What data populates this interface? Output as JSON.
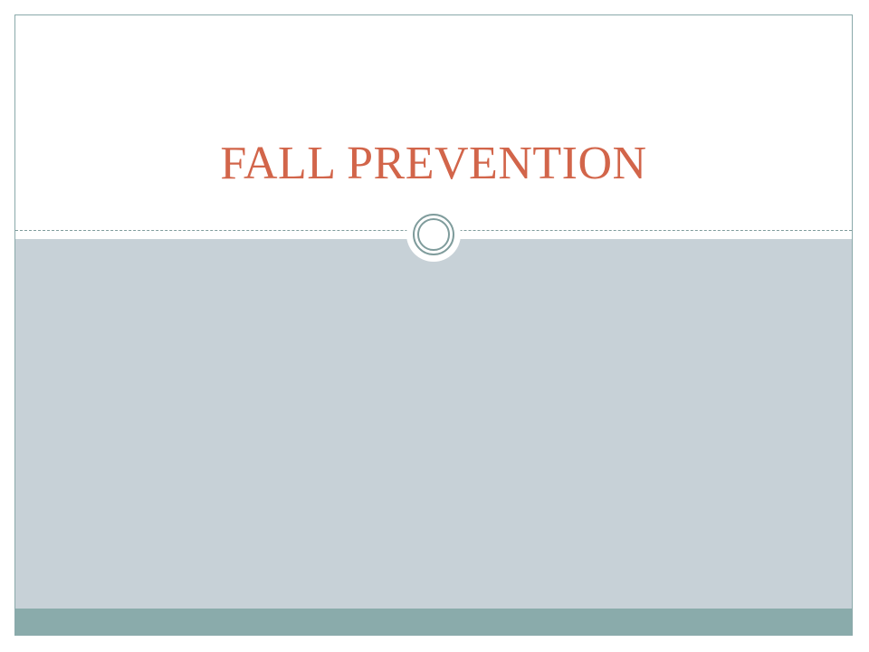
{
  "slide": {
    "title": "FALL PREVENTION",
    "colors": {
      "title": "#d2654a",
      "body_band": "#c7d1d7",
      "footer_band": "#8aabab",
      "accent": "#7f9c9c"
    }
  }
}
